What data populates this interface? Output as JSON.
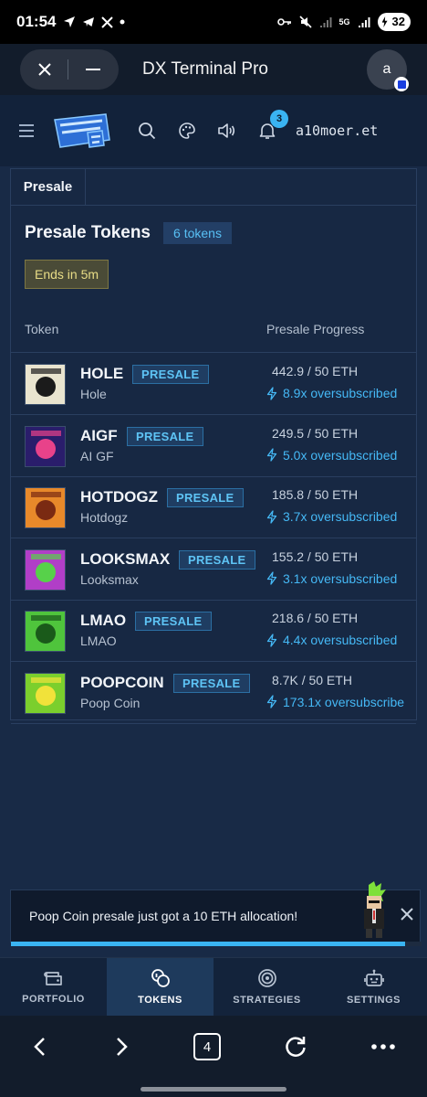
{
  "status_bar": {
    "time": "01:54",
    "network_label": "5G",
    "battery": "32"
  },
  "browser": {
    "title": "DX Terminal Pro",
    "avatar_letter": "a",
    "tab_count": "4"
  },
  "app_header": {
    "notification_count": "3",
    "username": "a10moer.et"
  },
  "tabs": [
    {
      "label": "Presale"
    }
  ],
  "section": {
    "heading": "Presale Tokens",
    "token_count": "6 tokens",
    "ends_label": "Ends in 5m"
  },
  "table": {
    "col_token": "Token",
    "col_progress": "Presale Progress",
    "badge_label": "PRESALE",
    "rows": [
      {
        "symbol": "HOLE",
        "name": "Hole",
        "raised": "442.9 / 50 ETH",
        "oversub": "8.9x oversubscribed",
        "thumb_color": "#e9e4cf",
        "thumb_accent": "#1b1b1b"
      },
      {
        "symbol": "AIGF",
        "name": "AI GF",
        "raised": "249.5 / 50 ETH",
        "oversub": "5.0x oversubscribed",
        "thumb_color": "#2a1d6b",
        "thumb_accent": "#e8428a"
      },
      {
        "symbol": "HOTDOGZ",
        "name": "Hotdogz",
        "raised": "185.8 / 50 ETH",
        "oversub": "3.7x oversubscribed",
        "thumb_color": "#e8892a",
        "thumb_accent": "#7a2a12"
      },
      {
        "symbol": "LOOKSMAX",
        "name": "Looksmax",
        "raised": "155.2 / 50 ETH",
        "oversub": "3.1x oversubscribed",
        "thumb_color": "#b13ec7",
        "thumb_accent": "#57d14a"
      },
      {
        "symbol": "LMAO",
        "name": "LMAO",
        "raised": "218.6 / 50 ETH",
        "oversub": "4.4x oversubscribed",
        "thumb_color": "#4fc43c",
        "thumb_accent": "#1a5a1a"
      },
      {
        "symbol": "POOPCOIN",
        "name": "Poop Coin",
        "raised": "8.7K / 50 ETH",
        "oversub": "173.1x oversubscribe",
        "thumb_color": "#7bcf2d",
        "thumb_accent": "#f1e23a"
      }
    ]
  },
  "toast": {
    "message": "Poop Coin presale just got a 10 ETH allocation!",
    "progress": 0.96
  },
  "bottom_nav": [
    {
      "label": "PORTFOLIO",
      "icon": "wallet-icon"
    },
    {
      "label": "TOKENS",
      "icon": "coins-icon"
    },
    {
      "label": "STRATEGIES",
      "icon": "target-icon"
    },
    {
      "label": "SETTINGS",
      "icon": "robot-icon"
    }
  ],
  "colors": {
    "accent": "#3ab4f2",
    "background": "#182a46",
    "header": "#12223a",
    "warning": "#e8dc86"
  }
}
